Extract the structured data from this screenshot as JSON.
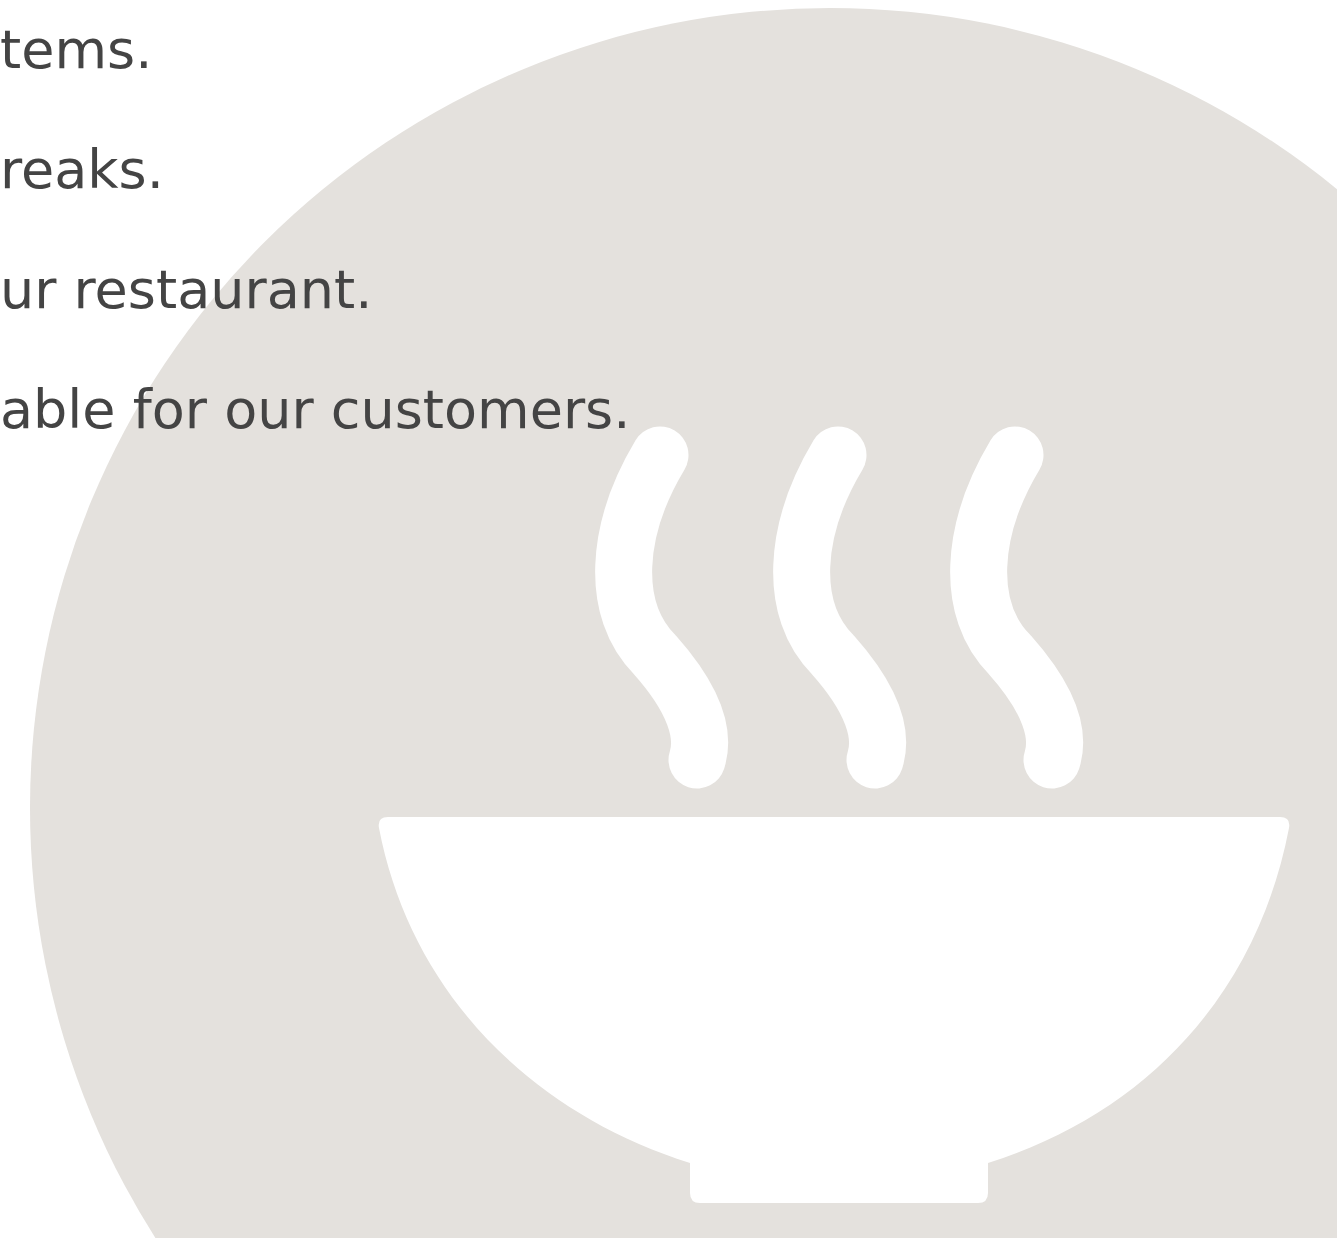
{
  "lines": [
    "tems.",
    "reaks.",
    "ur restaurant.",
    "able for our customers."
  ]
}
